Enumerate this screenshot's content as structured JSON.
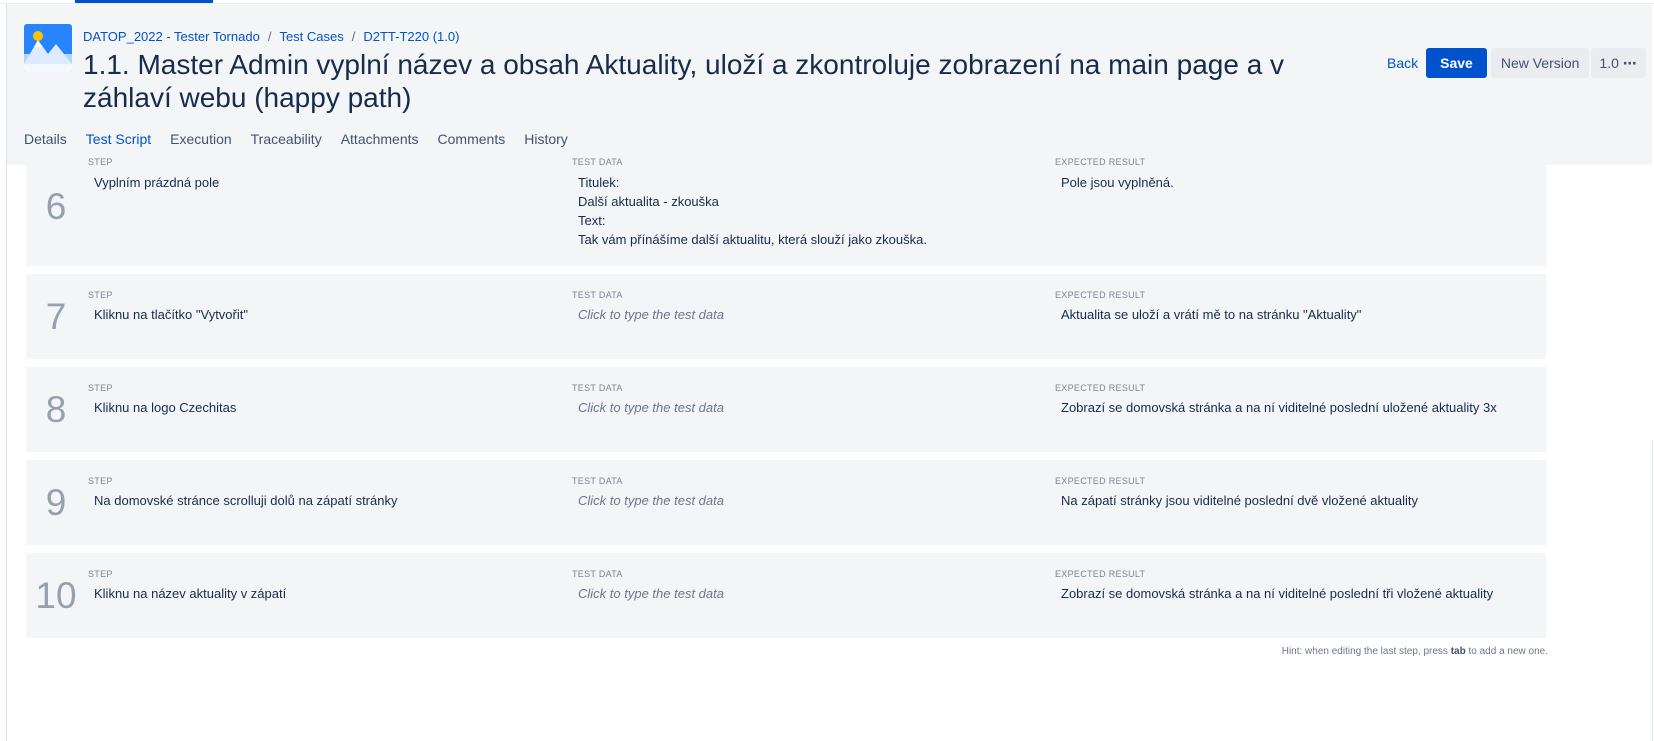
{
  "breadcrumb": {
    "project": "DATOP_2022 - Tester Tornado",
    "section": "Test Cases",
    "item": "D2TT-T220 (1.0)"
  },
  "title": "1.1. Master Admin vyplní název a obsah Aktuality, uloží a zkontroluje zobrazení na main page a v záhlaví webu (happy path)",
  "actions": {
    "back": "Back",
    "save": "Save",
    "new_version": "New Version",
    "version": "1.0"
  },
  "tabs": [
    {
      "label": "Details"
    },
    {
      "label": "Test Script"
    },
    {
      "label": "Execution"
    },
    {
      "label": "Traceability"
    },
    {
      "label": "Attachments"
    },
    {
      "label": "Comments"
    },
    {
      "label": "History"
    }
  ],
  "column_labels": {
    "step": "Step",
    "test_data": "Test Data",
    "expected": "Expected Result"
  },
  "steps": [
    {
      "number": "6",
      "step": "Vyplním prázdná pole",
      "test_data": [
        "Titulek:",
        "Další aktualita - zkouška",
        "Text:",
        "Tak vám přínášíme další aktualitu, která slouží jako zkouška."
      ],
      "test_data_placeholder": false,
      "expected": "Pole jsou vyplněná."
    },
    {
      "number": "7",
      "step": "Kliknu na tlačítko \"Vytvořit\"",
      "test_data": [
        "Click to type the test data"
      ],
      "test_data_placeholder": true,
      "expected": "Aktualita se uloží a vrátí mě to na stránku \"Aktuality\""
    },
    {
      "number": "8",
      "step": "Kliknu na logo Czechitas",
      "test_data": [
        "Click to type the test data"
      ],
      "test_data_placeholder": true,
      "expected": "Zobrazí se domovská stránka a na ní viditelné poslední uložené aktuality 3x"
    },
    {
      "number": "9",
      "step": "Na domovské stránce scrolluji dolů na zápatí stránky",
      "test_data": [
        "Click to type the test data"
      ],
      "test_data_placeholder": true,
      "expected": "Na zápatí stránky jsou viditelné poslední dvě vložené aktuality"
    },
    {
      "number": "10",
      "step": "Kliknu na název aktuality v zápatí",
      "test_data": [
        "Click to type the test data"
      ],
      "test_data_placeholder": true,
      "expected": "Zobrazí se domovská stránka a na ní viditelné poslední tři vložené aktuality"
    }
  ],
  "hint": {
    "prefix": "Hint: when editing the last step, press",
    "key": "tab",
    "suffix": "to add a new one."
  }
}
